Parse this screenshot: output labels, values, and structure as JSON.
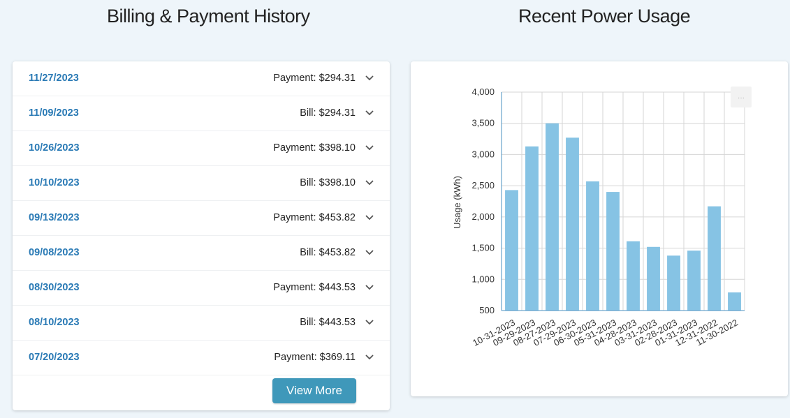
{
  "billing": {
    "title": "Billing & Payment History",
    "rows": [
      {
        "date": "11/27/2023",
        "amount": "Payment: $294.31"
      },
      {
        "date": "11/09/2023",
        "amount": "Bill: $294.31"
      },
      {
        "date": "10/26/2023",
        "amount": "Payment: $398.10"
      },
      {
        "date": "10/10/2023",
        "amount": "Bill: $398.10"
      },
      {
        "date": "09/13/2023",
        "amount": "Payment: $453.82"
      },
      {
        "date": "09/08/2023",
        "amount": "Bill: $453.82"
      },
      {
        "date": "08/30/2023",
        "amount": "Payment: $443.53"
      },
      {
        "date": "08/10/2023",
        "amount": "Bill: $443.53"
      },
      {
        "date": "07/20/2023",
        "amount": "Payment: $369.11"
      }
    ],
    "view_more_label": "View More",
    "accent_color": "#2a7ab5",
    "button_color": "#3f98ba"
  },
  "usage": {
    "title": "Recent Power Usage",
    "menu_label": "···"
  },
  "chart_data": {
    "type": "bar",
    "title": "",
    "xlabel": "",
    "ylabel": "Usage (kWh)",
    "ylim": [
      500,
      4000
    ],
    "yticks": [
      500,
      1000,
      1500,
      2000,
      2500,
      3000,
      3500,
      4000
    ],
    "ytick_labels": [
      "500",
      "1,000",
      "1,500",
      "2,000",
      "2,500",
      "3,000",
      "3,500",
      "4,000"
    ],
    "categories": [
      "10-31-2023",
      "09-29-2023",
      "08-27-2023",
      "07-29-2023",
      "06-30-2023",
      "05-31-2023",
      "04-28-2023",
      "03-31-2023",
      "02-28-2023",
      "01-31-2023",
      "12-31-2022",
      "11-30-2022"
    ],
    "values": [
      2430,
      3130,
      3500,
      3270,
      2570,
      2400,
      1610,
      1520,
      1380,
      1460,
      2170,
      790
    ],
    "bar_color": "#86c3e4",
    "grid": true
  }
}
